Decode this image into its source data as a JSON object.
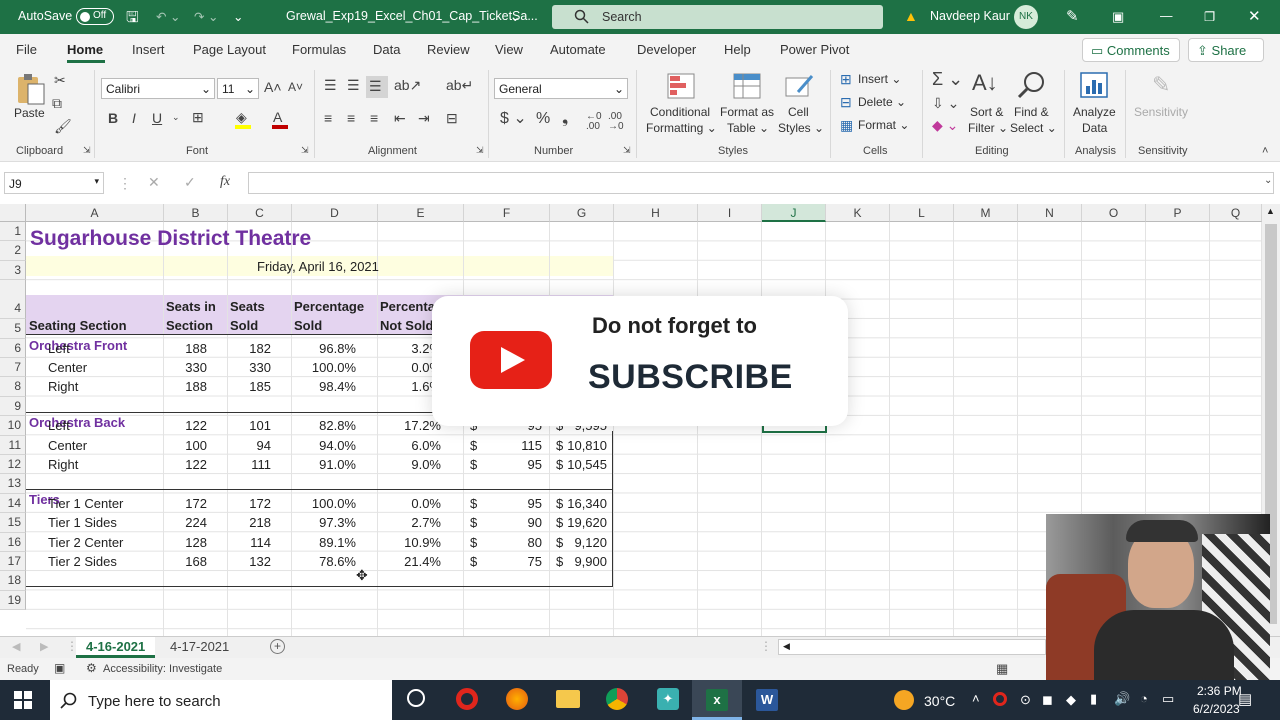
{
  "titlebar": {
    "autosave_label": "AutoSave",
    "autosave_state": "Off",
    "filename": "Grewal_Exp19_Excel_Ch01_Cap_TicketSa...",
    "search_placeholder": "Search",
    "user_name": "Navdeep Kaur",
    "user_initials": "NK"
  },
  "menu": {
    "tabs": [
      "File",
      "Home",
      "Insert",
      "Page Layout",
      "Formulas",
      "Data",
      "Review",
      "View",
      "Automate",
      "Developer",
      "Help",
      "Power Pivot"
    ],
    "comments_label": "Comments",
    "share_label": "Share"
  },
  "ribbon": {
    "paste_label": "Paste",
    "clipboard_label": "Clipboard",
    "font_name": "Calibri",
    "font_size": "11",
    "font_label": "Font",
    "alignment_label": "Alignment",
    "number_format": "General",
    "number_label": "Number",
    "conditional_formatting": [
      "Conditional",
      "Formatting"
    ],
    "format_as_table": [
      "Format as",
      "Table"
    ],
    "cell_styles": [
      "Cell",
      "Styles"
    ],
    "styles_label": "Styles",
    "insert_label": "Insert",
    "delete_label": "Delete",
    "format_label": "Format",
    "cells_label": "Cells",
    "sort_filter": [
      "Sort &",
      "Filter"
    ],
    "find_select": [
      "Find &",
      "Select"
    ],
    "editing_label": "Editing",
    "analyze_data": [
      "Analyze",
      "Data"
    ],
    "analysis_label": "Analysis",
    "sensitivity_btn": "Sensitivity",
    "sensitivity_label": "Sensitivity"
  },
  "formula_bar": {
    "name_box": "J9",
    "fx": "fx",
    "formula": ""
  },
  "columns": [
    "A",
    "B",
    "C",
    "D",
    "E",
    "F",
    "G",
    "H",
    "I",
    "J",
    "K",
    "L",
    "M",
    "N",
    "O",
    "P",
    "Q"
  ],
  "rows": [
    "1",
    "2",
    "3",
    "4",
    "5",
    "6",
    "7",
    "8",
    "9",
    "10",
    "11",
    "12",
    "13",
    "14",
    "15",
    "16",
    "17",
    "18",
    "19"
  ],
  "sheet": {
    "title": "Sugarhouse District Theatre",
    "date": "Friday, April 16, 2021",
    "headers": {
      "a": "Seating Section",
      "b": [
        "Seats in",
        "Section"
      ],
      "c": [
        "Seats",
        "Sold"
      ],
      "d": [
        "Percentage",
        "Sold"
      ],
      "e": [
        "Percenta",
        "Not Sold"
      ]
    },
    "groups": [
      "Orchestra Front",
      "Orchestra Back",
      "Tiers"
    ],
    "data_rows": [
      {
        "row": 6,
        "a": "Left",
        "b": "188",
        "c": "182",
        "d": "96.8%",
        "e": "3.2%",
        "f": "",
        "g": ""
      },
      {
        "row": 7,
        "a": "Center",
        "b": "330",
        "c": "330",
        "d": "100.0%",
        "e": "0.0%",
        "f": "",
        "g": ""
      },
      {
        "row": 8,
        "a": "Right",
        "b": "188",
        "c": "185",
        "d": "98.4%",
        "e": "1.6%",
        "f": "",
        "g": ""
      },
      {
        "row": 10,
        "a": "Left",
        "b": "122",
        "c": "101",
        "d": "82.8%",
        "e": "17.2%",
        "f": "95",
        "g": "9,595"
      },
      {
        "row": 11,
        "a": "Center",
        "b": "100",
        "c": "94",
        "d": "94.0%",
        "e": "6.0%",
        "f": "115",
        "g": "10,810"
      },
      {
        "row": 12,
        "a": "Right",
        "b": "122",
        "c": "111",
        "d": "91.0%",
        "e": "9.0%",
        "f": "95",
        "g": "10,545"
      },
      {
        "row": 14,
        "a": "Tier 1 Center",
        "b": "172",
        "c": "172",
        "d": "100.0%",
        "e": "0.0%",
        "f": "95",
        "g": "16,340"
      },
      {
        "row": 15,
        "a": "Tier 1 Sides",
        "b": "224",
        "c": "218",
        "d": "97.3%",
        "e": "2.7%",
        "f": "90",
        "g": "19,620"
      },
      {
        "row": 16,
        "a": "Tier 2 Center",
        "b": "128",
        "c": "114",
        "d": "89.1%",
        "e": "10.9%",
        "f": "80",
        "g": "9,120"
      },
      {
        "row": 17,
        "a": "Tier 2 Sides",
        "b": "168",
        "c": "132",
        "d": "78.6%",
        "e": "21.4%",
        "f": "75",
        "g": "9,900"
      }
    ],
    "currency": "$"
  },
  "sheet_tabs": [
    "4-16-2021",
    "4-17-2021"
  ],
  "status": {
    "ready": "Ready",
    "accessibility": "Accessibility: Investigate"
  },
  "overlay": {
    "line1": "Do not forget to",
    "line2": "SUBSCRIBE"
  },
  "taskbar": {
    "search_placeholder": "Type here to search",
    "temperature": "30°C",
    "time": "2:36 PM",
    "date": "6/2/2023"
  }
}
